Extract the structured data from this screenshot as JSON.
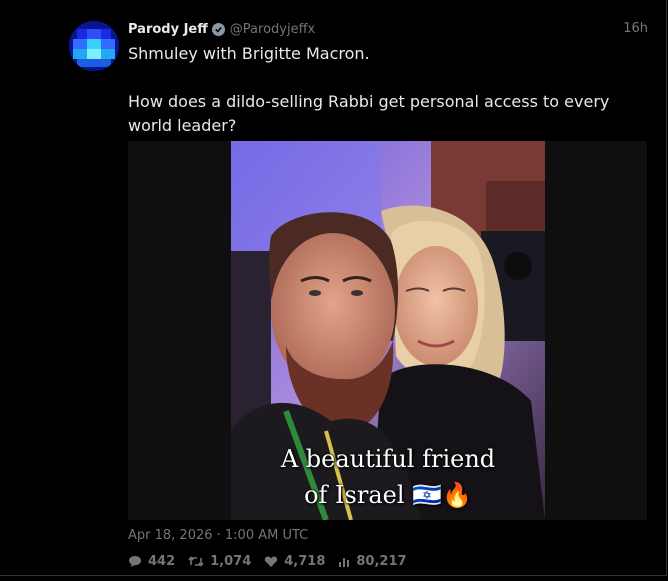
{
  "tweet": {
    "author_name": "Parody Jeff",
    "author_handle": "@Parodyjeffx",
    "time_ago": "16h",
    "text_line1": "Shmuley with Brigitte Macron.",
    "text_line2": "How does a dildo-selling Rabbi get personal access to every world leader?",
    "timestamp": "Apr 18, 2026 · 1:00 AM UTC"
  },
  "media": {
    "caption_line1": "A beautiful friend",
    "caption_line2": "of Israel 🇮🇱🔥"
  },
  "stats": {
    "replies": "442",
    "retweets": "1,074",
    "likes": "4,718",
    "views": "80,217"
  },
  "icons": {
    "reply": "comment-icon",
    "retweet": "retweet-icon",
    "like": "heart-icon",
    "views": "views-icon",
    "verified": "verified-badge-icon"
  },
  "colors": {
    "background": "#000000",
    "text": "#e7e9ea",
    "secondary": "#71767b",
    "avatar": "#0a1a8a"
  }
}
